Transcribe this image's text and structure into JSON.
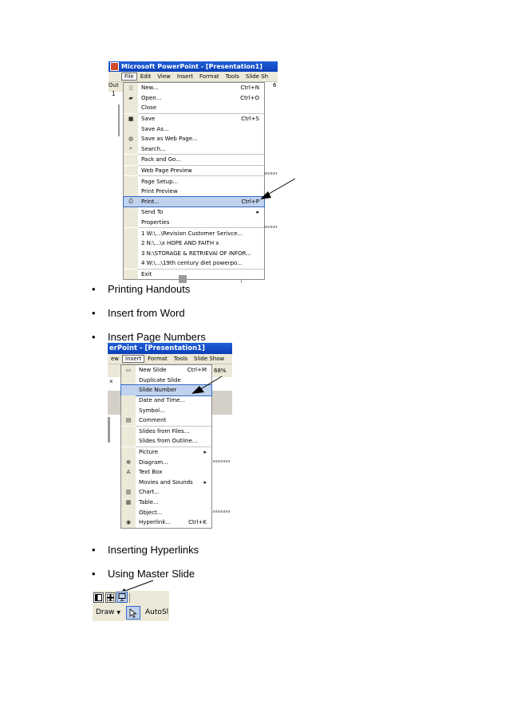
{
  "screenshot1": {
    "title": "Microsoft PowerPoint - [Presentation1]",
    "menubar": [
      "File",
      "Edit",
      "View",
      "Insert",
      "Format",
      "Tools",
      "Slide Sh"
    ],
    "partial_tab": "Out",
    "partial_zoom": "6",
    "file_menu": [
      {
        "label": "New...",
        "shortcut": "Ctrl+N",
        "icon": "new-doc-icon"
      },
      {
        "label": "Open...",
        "shortcut": "Ctrl+O",
        "icon": "open-folder-icon"
      },
      {
        "label": "Close",
        "shortcut": ""
      },
      {
        "sep": true
      },
      {
        "label": "Save",
        "shortcut": "Ctrl+S",
        "icon": "save-disk-icon"
      },
      {
        "label": "Save As...",
        "shortcut": ""
      },
      {
        "label": "Save as Web Page...",
        "shortcut": "",
        "icon": "web-page-icon"
      },
      {
        "label": "Search...",
        "shortcut": "",
        "icon": "search-icon"
      },
      {
        "sep": true
      },
      {
        "label": "Pack and Go...",
        "shortcut": ""
      },
      {
        "sep": true
      },
      {
        "label": "Web Page Preview",
        "shortcut": ""
      },
      {
        "sep": true
      },
      {
        "label": "Page Setup...",
        "shortcut": ""
      },
      {
        "label": "Print Preview",
        "shortcut": ""
      },
      {
        "label": "Print...",
        "shortcut": "Ctrl+P",
        "icon": "printer-icon",
        "highlight": true
      },
      {
        "sep": true
      },
      {
        "label": "Send To",
        "shortcut": "▸"
      },
      {
        "label": "Properties",
        "shortcut": ""
      },
      {
        "sep": true
      },
      {
        "label": "1 W:\\...\\Revision Customer Serivce...",
        "shortcut": ""
      },
      {
        "label": "2 N:\\...\\x HOPE AND FAITH x",
        "shortcut": ""
      },
      {
        "label": "3 N:\\STORAGE & RETRIEVAl OF INFOR...",
        "shortcut": ""
      },
      {
        "label": "4 W:\\...\\19th century diet powerpo...",
        "shortcut": ""
      },
      {
        "sep": true
      },
      {
        "label": "Exit",
        "shortcut": ""
      }
    ]
  },
  "bullets_a": [
    "Printing Handouts",
    "Insert from Word",
    "Insert Page Numbers"
  ],
  "bullet_symbol": "•",
  "screenshot2": {
    "title": "erPoint - [Presentation1]",
    "menubar": [
      "ew",
      "Insert",
      "Format",
      "Tools",
      "Slide Show"
    ],
    "zoom": "68%",
    "insert_menu": [
      {
        "label": "New Slide",
        "shortcut": "Ctrl+M",
        "icon": "new-slide-icon"
      },
      {
        "label": "Duplicate Slide",
        "shortcut": ""
      },
      {
        "label": "Slide Number",
        "shortcut": "",
        "highlight": true
      },
      {
        "label": "Date and Time...",
        "shortcut": ""
      },
      {
        "label": "Symbol...",
        "shortcut": ""
      },
      {
        "label": "Comment",
        "shortcut": "",
        "icon": "comment-icon"
      },
      {
        "sep": true
      },
      {
        "label": "Slides from Files...",
        "shortcut": ""
      },
      {
        "label": "Slides from Outline...",
        "shortcut": ""
      },
      {
        "sep": true
      },
      {
        "label": "Picture",
        "shortcut": "▸"
      },
      {
        "label": "Diagram...",
        "shortcut": "",
        "icon": "diagram-icon"
      },
      {
        "label": "Text Box",
        "shortcut": "",
        "icon": "text-box-icon"
      },
      {
        "label": "Movies and Sounds",
        "shortcut": "▸"
      },
      {
        "label": "Chart...",
        "shortcut": "",
        "icon": "chart-icon"
      },
      {
        "label": "Table...",
        "shortcut": "",
        "icon": "table-icon"
      },
      {
        "label": "Object...",
        "shortcut": ""
      },
      {
        "label": "Hyperlink...",
        "shortcut": "Ctrl+K",
        "icon": "hyperlink-globe-icon"
      }
    ]
  },
  "bullets_b": [
    "Inserting Hyperlinks",
    "Using Master Slide"
  ],
  "screenshot3": {
    "draw_label": "Draw",
    "autoshapes_label": "AutoSl"
  }
}
